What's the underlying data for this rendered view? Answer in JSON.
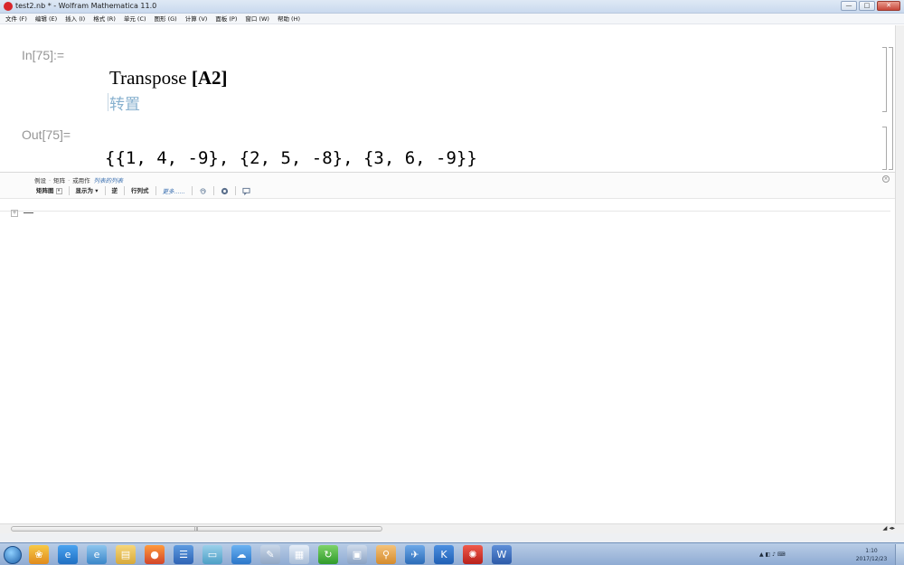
{
  "window": {
    "title": "test2.nb * - Wolfram Mathematica 11.0",
    "buttons": {
      "minimize": "—",
      "maximize": "□",
      "close": "✕"
    }
  },
  "menu": [
    "文件 (F)",
    "编辑 (E)",
    "插入 (I)",
    "格式 (R)",
    "单元 (C)",
    "图形 (G)",
    "计算 (V)",
    "面板 (P)",
    "窗口 (W)",
    "帮助 (H)"
  ],
  "notebook": {
    "input_label": "In[75]:=",
    "input_func": "Transpose",
    "input_arg": "[A2]",
    "input_hint": "转置",
    "output_label": "Out[75]=",
    "output_value": "{{1, 4, -9}, {2, 5, -8}, {3, 6, -9}}"
  },
  "suggestions": {
    "row1_a": "例设",
    "row1_b": "矩阵",
    "row1_c": "或用作",
    "row1_link": "列表的列表",
    "matrix_plot": "矩阵图",
    "display_as": "显示为",
    "inverse": "逆",
    "determinant": "行列式",
    "more": "更多......",
    "close_symbol": "×"
  },
  "new_cell_marker": "+",
  "zoom": "◢ ◂▸",
  "hscroll_grip": "III",
  "taskbar": {
    "clock_time": "1:10",
    "clock_date": "2017/12/23",
    "tray_text": "▲ ◧ ♪ ⌨"
  },
  "colors": {
    "label_gray": "#969696",
    "hint_blue": "#88b1cf",
    "link_blue": "#3a6fb0",
    "taskbar": "#8fabd3"
  }
}
